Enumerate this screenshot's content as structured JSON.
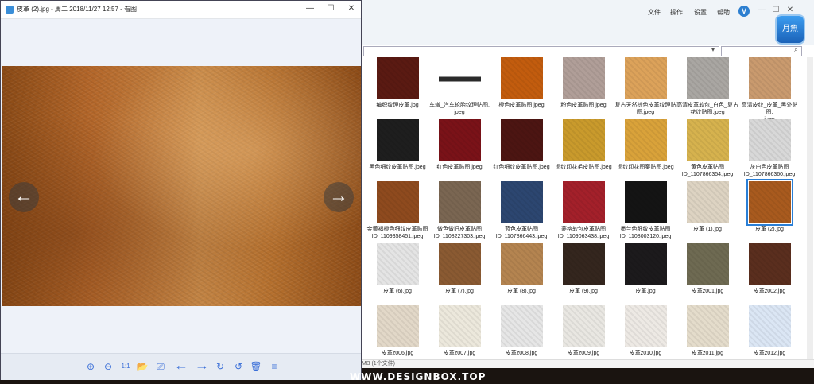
{
  "viewer": {
    "title": "皮革 (2).jpg - 周二 2018/11/27 12:57 - 看图",
    "controls": {
      "minimize": "—",
      "maximize": "☐",
      "close": "✕"
    },
    "nav_prev": "←",
    "nav_next": "→",
    "toolbar": {
      "zoom_in": "⊕",
      "zoom_out": "⊖",
      "actual_size": "1:1",
      "open_folder": "📂",
      "slideshow": "⎚",
      "previous": "←",
      "next": "→",
      "rotate_right": "↻",
      "rotate_left": "↺",
      "delete": "🗑",
      "menu": "≡"
    }
  },
  "explorer": {
    "menu": {
      "file": "文件",
      "action": "操作",
      "settings": "设置",
      "help": "帮助"
    },
    "controls": {
      "minimize": "—",
      "maximize": "☐",
      "close": "✕"
    },
    "logo_v": "V",
    "badge": "月魚",
    "address_dropdown": "▾",
    "search_icon": "⌕",
    "status": "MB (1个文件)",
    "thumbnails": [
      {
        "caption": "编织纹理皮革.jpg",
        "color": "#5a1a12",
        "row": 0,
        "col": 0
      },
      {
        "caption": "车辙_汽车轮胎纹理贴图.\njpeg",
        "color": "#2a2a2a",
        "row": 0,
        "col": 1,
        "strip": true
      },
      {
        "caption": "橙色皮革贴图.jpeg",
        "color": "#c25c0e",
        "row": 0,
        "col": 2
      },
      {
        "caption": "粉色皮革贴图.jpeg",
        "color": "#b09e98",
        "row": 0,
        "col": 3
      },
      {
        "caption": "复古天然棕色皮革纹理贴\n图.jpeg",
        "color": "#dca25a",
        "row": 0,
        "col": 4
      },
      {
        "caption": "高清皮革软包_白色_复古\n花纹贴图.jpeg",
        "color": "#a9a6a2",
        "row": 0,
        "col": 5
      },
      {
        "caption": "高清皮纹_皮革_黑外贴图.\njpeg",
        "color": "#c99a6e",
        "row": 0,
        "col": 6
      },
      {
        "caption": "黑色细纹皮革贴图.jpeg",
        "color": "#1e1e1e",
        "row": 1,
        "col": 0
      },
      {
        "caption": "红色皮革贴图.jpeg",
        "color": "#7a1218",
        "row": 1,
        "col": 1
      },
      {
        "caption": "红色细纹皮革贴图.jpeg",
        "color": "#4c1512",
        "row": 1,
        "col": 2
      },
      {
        "caption": "虎纹印花毛皮贴图.jpeg",
        "color": "#c99a2c",
        "row": 1,
        "col": 3
      },
      {
        "caption": "虎纹印花图案贴图.jpeg",
        "color": "#d9a23a",
        "row": 1,
        "col": 4
      },
      {
        "caption": "黄色皮革贴图\nID_1107866354.jpeg",
        "color": "#d6b24e",
        "row": 1,
        "col": 5
      },
      {
        "caption": "灰白色皮革贴图\nID_1107866360.jpeg",
        "color": "#d8d8d8",
        "row": 1,
        "col": 6
      },
      {
        "caption": "金黄褐橙色细纹皮革贴图\nID_1109358451.jpeg",
        "color": "#8e4a1e",
        "row": 2,
        "col": 0
      },
      {
        "caption": "做色做旧皮革贴图\nID_1108227303.jpeg",
        "color": "#7a6652",
        "row": 2,
        "col": 1
      },
      {
        "caption": "蓝色皮革贴图\nID_1107866443.jpeg",
        "color": "#2c4670",
        "row": 2,
        "col": 2
      },
      {
        "caption": "菱格软包皮革贴图\nID_1109063438.jpeg",
        "color": "#a3202a",
        "row": 2,
        "col": 3
      },
      {
        "caption": "墨兰色细纹皮革贴图\nID_1108003120.jpeg",
        "color": "#141414",
        "row": 2,
        "col": 4
      },
      {
        "caption": "皮革 (1).jpg",
        "color": "#ddd3c2",
        "row": 2,
        "col": 5
      },
      {
        "caption": "皮革 (2).jpg",
        "color": "#a85a1e",
        "row": 2,
        "col": 6,
        "selected": true
      },
      {
        "caption": "皮革 (6).jpg",
        "color": "#e4e4e4",
        "row": 3,
        "col": 0
      },
      {
        "caption": "皮革 (7).jpg",
        "color": "#8a5a32",
        "row": 3,
        "col": 1
      },
      {
        "caption": "皮革 (8).jpg",
        "color": "#b48450",
        "row": 3,
        "col": 2
      },
      {
        "caption": "皮革 (9).jpg",
        "color": "#34261e",
        "row": 3,
        "col": 3
      },
      {
        "caption": "皮革.jpg",
        "color": "#1c1a1c",
        "row": 3,
        "col": 4
      },
      {
        "caption": "皮革z001.jpg",
        "color": "#6e6a52",
        "row": 3,
        "col": 5
      },
      {
        "caption": "皮革z002.jpg",
        "color": "#5a2e1e",
        "row": 3,
        "col": 6
      },
      {
        "caption": "皮革z006.jpg",
        "color": "#e2d8c8",
        "row": 4,
        "col": 0
      },
      {
        "caption": "皮革z007.jpg",
        "color": "#ece8dc",
        "row": 4,
        "col": 1
      },
      {
        "caption": "皮革z008.jpg",
        "color": "#e6e6e6",
        "row": 4,
        "col": 2
      },
      {
        "caption": "皮革z009.jpg",
        "color": "#e9e7e2",
        "row": 4,
        "col": 3
      },
      {
        "caption": "皮革z010.jpg",
        "color": "#ede9e4",
        "row": 4,
        "col": 4
      },
      {
        "caption": "皮革z011.jpg",
        "color": "#e4dccb",
        "row": 4,
        "col": 5
      },
      {
        "caption": "皮革z012.jpg",
        "color": "#dbe6f4",
        "row": 4,
        "col": 6
      }
    ]
  },
  "watermark": "WWW.DESIGNBOX.TOP"
}
